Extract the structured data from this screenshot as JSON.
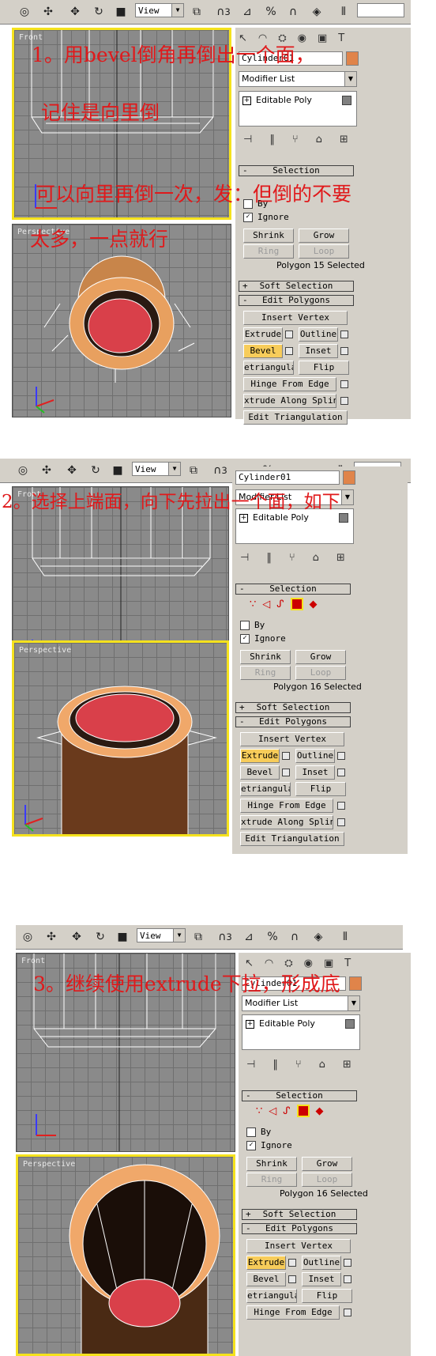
{
  "toolbar": {
    "view_label": "View",
    "snap_label": "3"
  },
  "object": {
    "name": "Cylinder01",
    "color": "#e0844a",
    "modifier_list_label": "Modifier List",
    "stack_item": "Editable Poly"
  },
  "rollouts": {
    "selection": "Selection",
    "soft_selection": "Soft Selection",
    "edit_polygons": "Edit Polygons",
    "by_label": "By",
    "ignore_label": "Ignore",
    "shrink": "Shrink",
    "grow": "Grow",
    "ring": "Ring",
    "loop": "Loop",
    "insert_vertex": "Insert Vertex",
    "extrude": "Extrude",
    "outline": "Outline",
    "bevel": "Bevel",
    "inset": "Inset",
    "retriangulate": "etriangulat",
    "flip": "Flip",
    "hinge_from_edge": "Hinge From Edge",
    "extrude_along_spline": "xtrude Along Spline",
    "edit_triangulation": "Edit Triangulation",
    "minus": "-",
    "plus": "+"
  },
  "viewports": {
    "front": "Front",
    "perspective": "Perspective"
  },
  "panels": [
    {
      "selected_text": "Polygon 15 Selected",
      "highlight_button": "bevel"
    },
    {
      "selected_text": "Polygon 16 Selected",
      "highlight_button": "extrude"
    },
    {
      "selected_text": "Polygon 16 Selected",
      "highlight_button": "extrude"
    }
  ],
  "annotations": {
    "step1_line1": "1。用bevel倒角再倒出一个面，",
    "step1_line2": "记住是向里倒",
    "step1_line3": "可以向里再倒一次，发：但倒的不要",
    "step1_line4": "太多，一点就行",
    "step2": "2。选择上端面，向下先拉出一个面，如下",
    "step3": "3。继续使用extrude下拉，形成底"
  },
  "colors": {
    "annotation": "#e0191b",
    "active_viewport_border": "#f5e21d",
    "ui_gray": "#d4d0c8",
    "highlight_button": "#f7cc5a"
  }
}
